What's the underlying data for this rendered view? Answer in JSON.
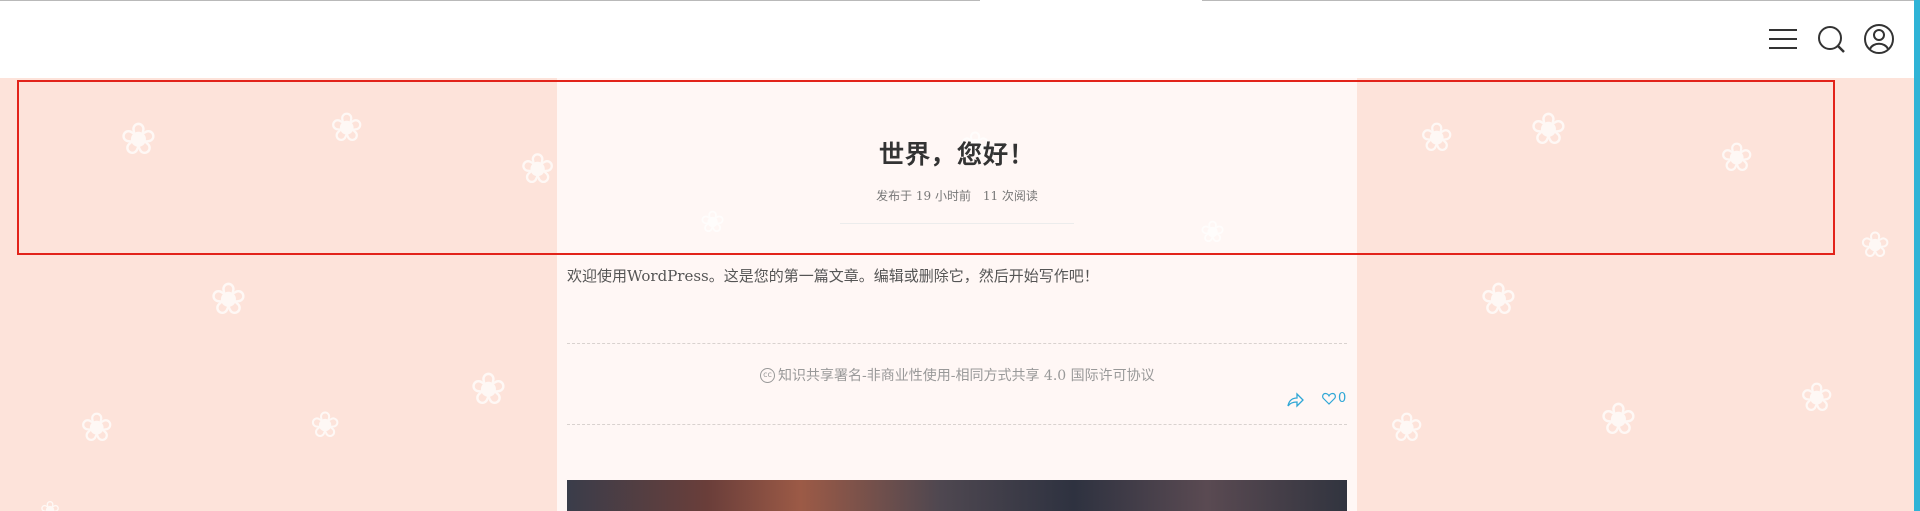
{
  "header": {
    "menu_icon": "hamburger-menu-icon",
    "search_icon": "search-icon",
    "user_icon": "user-icon"
  },
  "post": {
    "title": "世界，您好！",
    "meta_published": "发布于 19 小时前",
    "meta_views": "11 次阅读",
    "excerpt": "欢迎使用WordPress。这是您的第一篇文章。编辑或删除它，然后开始写作吧！",
    "license_text": "知识共享署名-非商业性使用-相同方式共享 4.0 国际许可协议",
    "license_icon": "creative-commons-icon",
    "share_icon": "share-icon",
    "like_icon": "heart-icon",
    "like_count": "0"
  },
  "colors": {
    "background": "#fde3da",
    "accent": "#2fa7d6",
    "highlight_border": "#e2231a"
  }
}
